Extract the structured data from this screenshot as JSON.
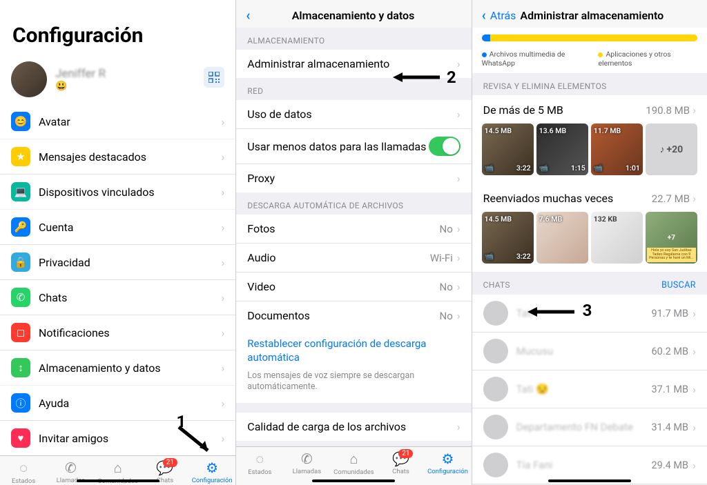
{
  "s1": {
    "title": "Configuración",
    "profile_name": "Jeniffer R",
    "profile_emoji": "😃",
    "rows": {
      "avatar": "Avatar",
      "starred": "Mensajes destacados",
      "linked": "Dispositivos vinculados",
      "account": "Cuenta",
      "privacy": "Privacidad",
      "chats": "Chats",
      "notifications": "Notificaciones",
      "storage": "Almacenamiento y datos",
      "help": "Ayuda",
      "invite": "Invitar amigos"
    },
    "tabs": {
      "estados": "Estados",
      "llamadas": "Llamadas",
      "comunidades": "Comunidades",
      "chats": "Chats",
      "config": "Configuración",
      "chat_badge": "21"
    }
  },
  "s2": {
    "title": "Almacenamiento y datos",
    "sections": {
      "storage": "Almacenamiento",
      "red": "Red",
      "autodl": "Descarga automática de archivos"
    },
    "rows": {
      "manage": "Administrar almacenamiento",
      "data_usage": "Uso de datos",
      "low_data_calls": "Usar menos datos para las llamadas",
      "proxy": "Proxy",
      "photos": "Fotos",
      "audio": "Audio",
      "video": "Video",
      "documents": "Documentos",
      "quality": "Calidad de carga de los archivos"
    },
    "values": {
      "photos": "No",
      "audio": "Wi-Fi",
      "video": "No",
      "documents": "No"
    },
    "reset_link": "Restablecer configuración de descarga automática",
    "voice_hint": "Los mensajes de voz siempre se descargan automáticamente."
  },
  "s3": {
    "back": "Atrás",
    "title": "Administrar almacenamiento",
    "legend_media": "Archivos multimedia de WhatsApp",
    "legend_other": "Aplicaciones y otros elementos",
    "review_header": "Revisa y elimina elementos",
    "large": {
      "label": "De más de 5 MB",
      "size": "190.8 MB"
    },
    "large_thumbs": [
      {
        "size": "14.5 MB",
        "dur": "3:22"
      },
      {
        "size": "13.6 MB",
        "dur": "1:15"
      },
      {
        "size": "11.7 MB",
        "dur": "1:01"
      }
    ],
    "large_more": "+20",
    "forwarded": {
      "label": "Reenviados muchas veces",
      "size": "22.7 MB"
    },
    "forwarded_thumbs": [
      {
        "size": "14.5 MB",
        "dur": "3:22"
      },
      {
        "size": "7.6 MB",
        "dur": ""
      },
      {
        "size": "132 KB",
        "dur": ""
      }
    ],
    "forwarded_more": "+7",
    "forwarded_note": "Hola yo soy San Juditas Tadeo Regálame con 9 Personas y te haré un Mi...",
    "chats_header": "Chats",
    "search": "BUSCAR",
    "chats": [
      {
        "name": "Tati",
        "size": "91.7 MB"
      },
      {
        "name": "Mucusu",
        "size": "60.2 MB"
      },
      {
        "name": "Tati 😒",
        "size": "37.1 MB"
      },
      {
        "name": "Departamento FN Debate",
        "size": "31.4 MB"
      },
      {
        "name": "Tía Fani",
        "size": "29.4 MB"
      }
    ]
  },
  "annotations": {
    "n1": "1",
    "n2": "2",
    "n3": "3"
  }
}
